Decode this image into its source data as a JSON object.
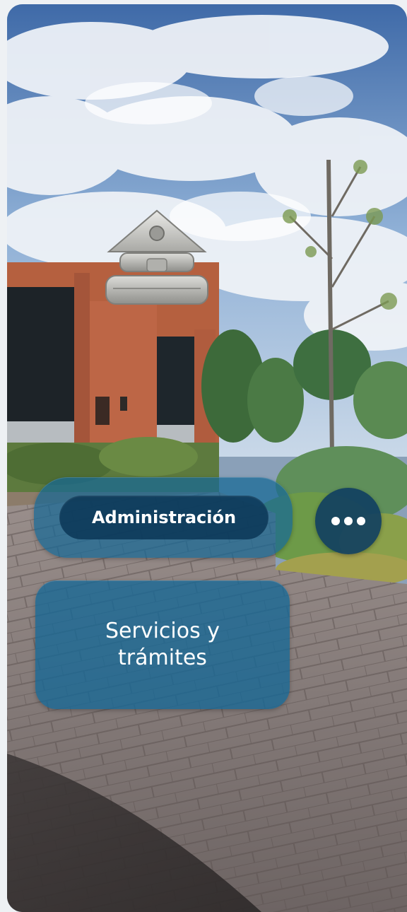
{
  "navigation": {
    "primary_label": "Administración",
    "secondary_label": "Servicios y trámites",
    "more_icon": "more-horizontal-icon"
  },
  "scene": {
    "marker_icon": "home-marker-icon",
    "description_icons": [
      "sky",
      "building",
      "tree",
      "paved-plaza"
    ]
  },
  "colors": {
    "accent": "#1668a0",
    "accent_dark": "#0b3656",
    "text": "#ffffff"
  }
}
